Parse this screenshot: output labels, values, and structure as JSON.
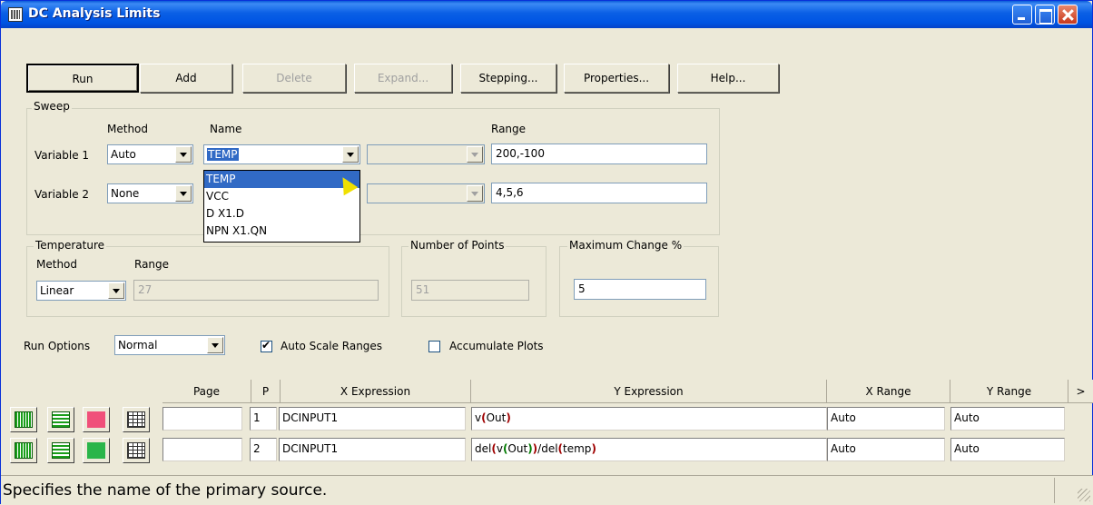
{
  "window": {
    "title": "DC Analysis Limits"
  },
  "toolbar": {
    "run": "Run",
    "add": "Add",
    "delete": "Delete",
    "expand": "Expand...",
    "stepping": "Stepping...",
    "properties": "Properties...",
    "help": "Help..."
  },
  "sweep": {
    "title": "Sweep",
    "method_header": "Method",
    "name_header": "Name",
    "range_header": "Range",
    "var1_label": "Variable 1",
    "var1_method": "Auto",
    "var1_name": "TEMP",
    "var1_range": "200,-100",
    "var2_label": "Variable 2",
    "var2_method": "None",
    "var2_range": "4,5,6"
  },
  "name_dropdown": {
    "items": [
      "TEMP",
      "VCC",
      "D X1.D",
      "NPN X1.QN"
    ],
    "highlighted": 0
  },
  "temperature": {
    "title": "Temperature",
    "method_label": "Method",
    "range_label": "Range",
    "method": "Linear",
    "range": "27"
  },
  "points": {
    "title": "Number of Points",
    "value": "51"
  },
  "max_change": {
    "title": "Maximum Change %",
    "value": "5"
  },
  "run_options": {
    "label": "Run Options",
    "value": "Normal",
    "auto_scale_label": "Auto Scale Ranges",
    "auto_scale_checked": true,
    "accumulate_label": "Accumulate Plots",
    "accumulate_checked": false
  },
  "table": {
    "headers": {
      "page": "Page",
      "p": "P",
      "x_expr": "X Expression",
      "y_expr": "Y Expression",
      "x_range": "X Range",
      "y_range": "Y Range",
      "more": ">"
    },
    "rows": [
      {
        "page": "",
        "p": "1",
        "x_expr": "DCINPUT1",
        "y_expr_parts": [
          "v",
          "(",
          "Out",
          ")"
        ],
        "x_range": "Auto",
        "y_range": "Auto",
        "color": "#f0507a"
      },
      {
        "page": "",
        "p": "2",
        "x_expr": "DCINPUT1",
        "y_expr_parts": [
          "del",
          "(",
          "v",
          "(",
          "Out",
          ")",
          ")",
          "/del",
          "(",
          "temp",
          ")"
        ],
        "x_range": "Auto",
        "y_range": "Auto",
        "color": "#2ab54a"
      }
    ]
  },
  "status": {
    "text": "Specifies the name of the primary source."
  }
}
